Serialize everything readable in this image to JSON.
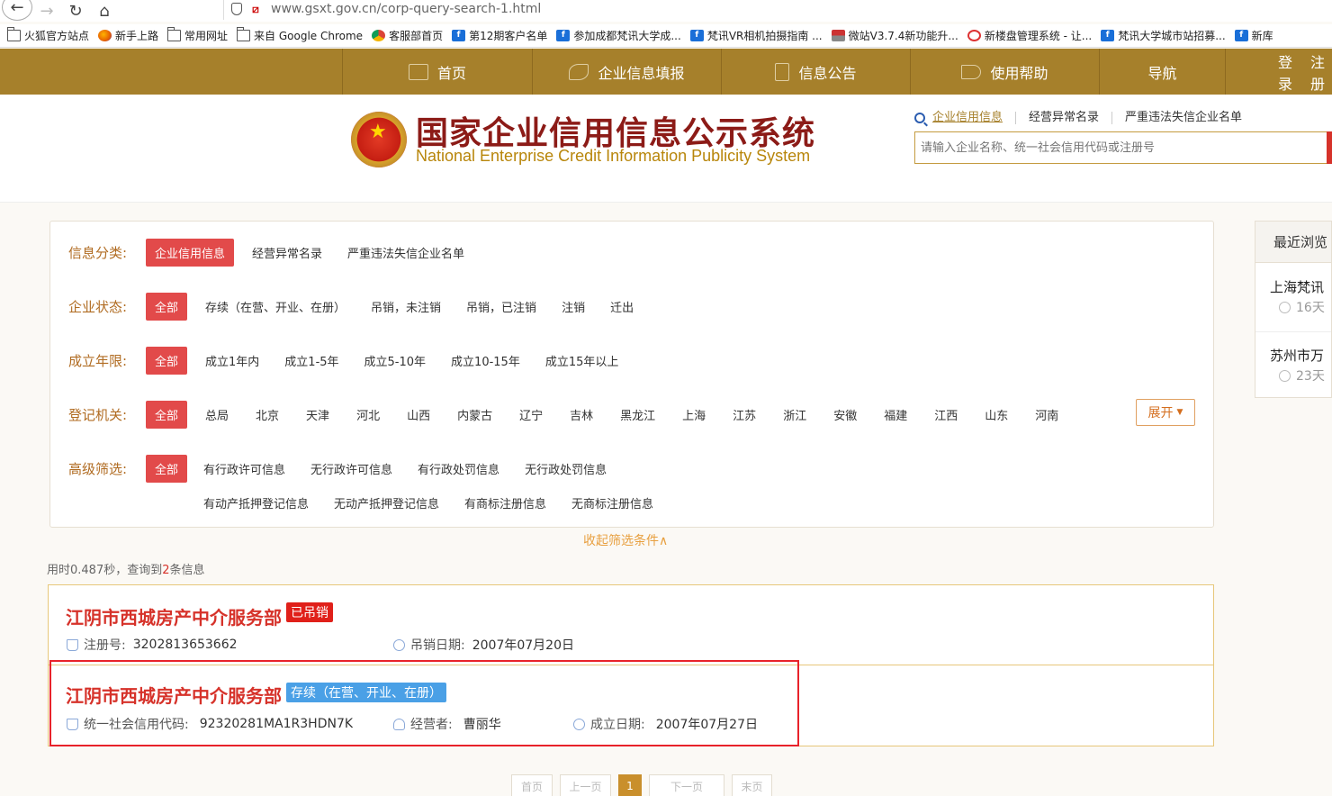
{
  "browser": {
    "url": "www.gsxt.gov.cn/corp-query-search-1.html",
    "bookmarks": [
      {
        "label": "火狐官方站点",
        "icon": "folder-icon"
      },
      {
        "label": "新手上路",
        "icon": "firefox-icon"
      },
      {
        "label": "常用网址",
        "icon": "folder-icon"
      },
      {
        "label": "来自 Google Chrome",
        "icon": "folder-icon"
      },
      {
        "label": "客服部首页",
        "icon": "chrome-icon"
      },
      {
        "label": "第12期客户名单",
        "icon": "fanxun-icon"
      },
      {
        "label": "参加成都梵讯大学成...",
        "icon": "fanxun-icon"
      },
      {
        "label": "梵讯VR相机拍摄指南 ...",
        "icon": "fanxun-icon"
      },
      {
        "label": "微站V3.7.4新功能升...",
        "icon": "house-icon"
      },
      {
        "label": "新楼盘管理系统 - 让...",
        "icon": "ie-icon"
      },
      {
        "label": "梵讯大学城市站招募...",
        "icon": "fanxun-icon"
      },
      {
        "label": "新库",
        "icon": "fanxun-icon"
      }
    ]
  },
  "topnav": {
    "home": "首页",
    "report": "企业信息填报",
    "notice": "信息公告",
    "help": "使用帮助",
    "guide": "导航",
    "login": "登录",
    "register": "注册"
  },
  "header": {
    "title_cn": "国家企业信用信息公示系统",
    "title_en": "National Enterprise Credit Information Publicity System",
    "search_tabs": [
      "企业信用信息",
      "经营异常名录",
      "严重违法失信企业名单"
    ],
    "search_placeholder": "请输入企业名称、统一社会信用代码或注册号"
  },
  "filters": {
    "category": {
      "label": "信息分类:",
      "options": [
        "企业信用信息",
        "经营异常名录",
        "严重违法失信企业名单"
      ]
    },
    "status": {
      "label": "企业状态:",
      "options": [
        "全部",
        "存续（在营、开业、在册）",
        "吊销，未注销",
        "吊销，已注销",
        "注销",
        "迁出"
      ]
    },
    "age": {
      "label": "成立年限:",
      "options": [
        "全部",
        "成立1年内",
        "成立1-5年",
        "成立5-10年",
        "成立10-15年",
        "成立15年以上"
      ]
    },
    "authority": {
      "label": "登记机关:",
      "options": [
        "全部",
        "总局",
        "北京",
        "天津",
        "河北",
        "山西",
        "内蒙古",
        "辽宁",
        "吉林",
        "黑龙江",
        "上海",
        "江苏",
        "浙江",
        "安徽",
        "福建",
        "江西",
        "山东",
        "河南"
      ]
    },
    "advanced": {
      "label": "高级筛选:",
      "options": [
        "全部",
        "有行政许可信息",
        "无行政许可信息",
        "有行政处罚信息",
        "无行政处罚信息"
      ],
      "options2": [
        "有动产抵押登记信息",
        "无动产抵押登记信息",
        "有商标注册信息",
        "无商标注册信息"
      ]
    },
    "expand": "展开",
    "collapse": "收起筛选条件∧"
  },
  "summary": {
    "prefix": "用时0.487秒，查询到",
    "count": "2",
    "suffix": "条信息"
  },
  "results": [
    {
      "name": "江阴市西城房产中介服务部",
      "badge": "已吊销",
      "reg_label": "注册号:",
      "reg_value": "3202813653662",
      "date_label": "吊销日期:",
      "date_value": "2007年07月20日"
    },
    {
      "name": "江阴市西城房产中介服务部",
      "badge": "存续（在营、开业、在册）",
      "reg_label": "统一社会信用代码:",
      "reg_value": "92320281MA1R3HDN7K",
      "op_label": "经营者:",
      "op_value": "曹丽华",
      "date_label": "成立日期:",
      "date_value": "2007年07月27日"
    }
  ],
  "pager": [
    "首页",
    "上一页",
    "1",
    "下一页",
    "末页"
  ],
  "recent": {
    "title": "最近浏览",
    "items": [
      {
        "name": "上海梵讯",
        "time": "16天"
      },
      {
        "name": "苏州市万",
        "time": "23天"
      }
    ]
  },
  "colors": {
    "accent": "#a6802b",
    "danger": "#d6322a",
    "badge_blue": "#4aa0e6"
  }
}
